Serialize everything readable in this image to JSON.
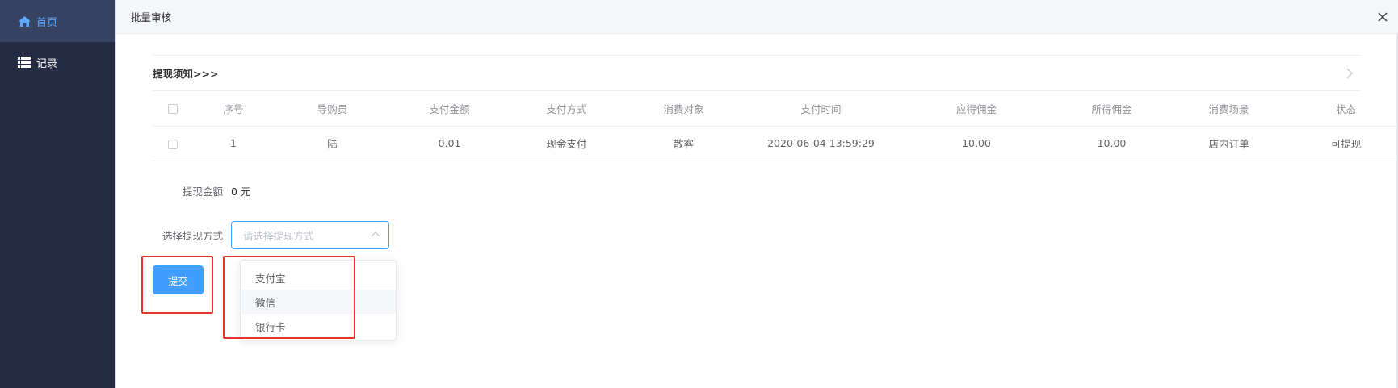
{
  "sidebar": {
    "items": [
      {
        "label": "首页",
        "icon": "home-icon",
        "active": true
      },
      {
        "label": "记录",
        "icon": "list-icon",
        "active": false
      }
    ]
  },
  "dialog": {
    "title": "批量审核",
    "notice_label": "提现须知>>>"
  },
  "table": {
    "headers": [
      "",
      "序号",
      "导购员",
      "支付金额",
      "支付方式",
      "消费对象",
      "支付时间",
      "应得佣金",
      "所得佣金",
      "消费场景",
      "状态"
    ],
    "rows": [
      [
        "",
        "1",
        "陆",
        "0.01",
        "现金支付",
        "散客",
        "2020-06-04 13:59:29",
        "10.00",
        "10.00",
        "店内订单",
        "可提现"
      ]
    ]
  },
  "form": {
    "amount_label": "提现金额",
    "amount_value": "0 元",
    "method_label": "选择提现方式",
    "method_placeholder": "请选择提现方式",
    "method_options": [
      "支付宝",
      "微信",
      "银行卡"
    ],
    "hovered_option": "微信"
  },
  "submit_label": "提交",
  "colors": {
    "primary": "#409eff",
    "sidebar_bg": "#242b42",
    "sidebar_active_bg": "#374363",
    "annotation_red": "#e8342e"
  }
}
